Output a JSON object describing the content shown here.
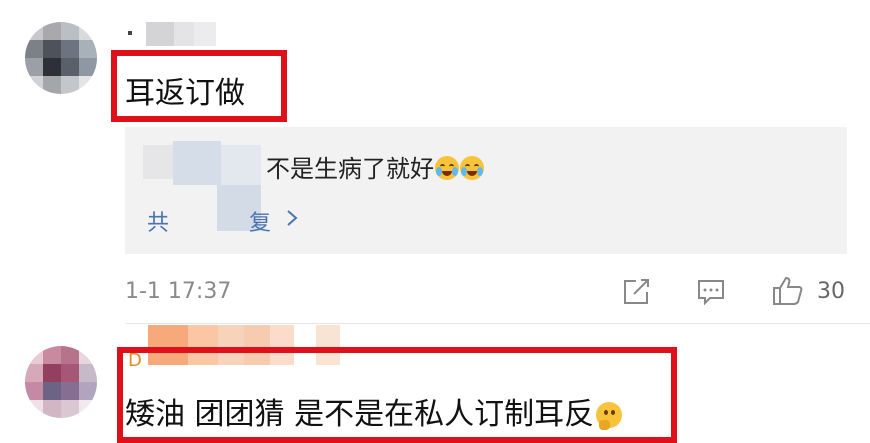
{
  "comments": [
    {
      "text": "耳返订做",
      "reply": {
        "text": "不是生病了就好",
        "more_label": "共",
        "more_label_tail": "复"
      },
      "time": "1-1 17:37",
      "like_count": "30",
      "icons": [
        "share-icon",
        "comment-icon",
        "like-icon"
      ]
    },
    {
      "username_fragment": "D",
      "text": "矮油 团团猜 是不是在私人订制耳反"
    }
  ],
  "colors": {
    "highlight": "#e0101a",
    "link": "#4a73b3",
    "reply_bg": "#f2f2f2",
    "meta": "#8a8a8a"
  },
  "emoji": {
    "reply": [
      "laugh-cry-emoji",
      "laugh-cry-emoji"
    ],
    "comment2": "thinking-emoji"
  }
}
